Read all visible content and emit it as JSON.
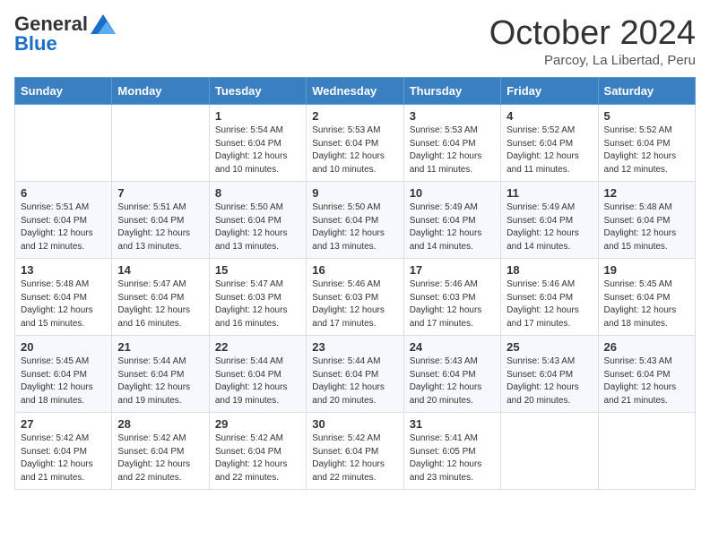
{
  "header": {
    "logo_general": "General",
    "logo_blue": "Blue",
    "title": "October 2024",
    "subtitle": "Parcoy, La Libertad, Peru"
  },
  "calendar": {
    "days_of_week": [
      "Sunday",
      "Monday",
      "Tuesday",
      "Wednesday",
      "Thursday",
      "Friday",
      "Saturday"
    ],
    "weeks": [
      [
        {
          "day": "",
          "info": ""
        },
        {
          "day": "",
          "info": ""
        },
        {
          "day": "1",
          "info": "Sunrise: 5:54 AM\nSunset: 6:04 PM\nDaylight: 12 hours and 10 minutes."
        },
        {
          "day": "2",
          "info": "Sunrise: 5:53 AM\nSunset: 6:04 PM\nDaylight: 12 hours and 10 minutes."
        },
        {
          "day": "3",
          "info": "Sunrise: 5:53 AM\nSunset: 6:04 PM\nDaylight: 12 hours and 11 minutes."
        },
        {
          "day": "4",
          "info": "Sunrise: 5:52 AM\nSunset: 6:04 PM\nDaylight: 12 hours and 11 minutes."
        },
        {
          "day": "5",
          "info": "Sunrise: 5:52 AM\nSunset: 6:04 PM\nDaylight: 12 hours and 12 minutes."
        }
      ],
      [
        {
          "day": "6",
          "info": "Sunrise: 5:51 AM\nSunset: 6:04 PM\nDaylight: 12 hours and 12 minutes."
        },
        {
          "day": "7",
          "info": "Sunrise: 5:51 AM\nSunset: 6:04 PM\nDaylight: 12 hours and 13 minutes."
        },
        {
          "day": "8",
          "info": "Sunrise: 5:50 AM\nSunset: 6:04 PM\nDaylight: 12 hours and 13 minutes."
        },
        {
          "day": "9",
          "info": "Sunrise: 5:50 AM\nSunset: 6:04 PM\nDaylight: 12 hours and 13 minutes."
        },
        {
          "day": "10",
          "info": "Sunrise: 5:49 AM\nSunset: 6:04 PM\nDaylight: 12 hours and 14 minutes."
        },
        {
          "day": "11",
          "info": "Sunrise: 5:49 AM\nSunset: 6:04 PM\nDaylight: 12 hours and 14 minutes."
        },
        {
          "day": "12",
          "info": "Sunrise: 5:48 AM\nSunset: 6:04 PM\nDaylight: 12 hours and 15 minutes."
        }
      ],
      [
        {
          "day": "13",
          "info": "Sunrise: 5:48 AM\nSunset: 6:04 PM\nDaylight: 12 hours and 15 minutes."
        },
        {
          "day": "14",
          "info": "Sunrise: 5:47 AM\nSunset: 6:04 PM\nDaylight: 12 hours and 16 minutes."
        },
        {
          "day": "15",
          "info": "Sunrise: 5:47 AM\nSunset: 6:03 PM\nDaylight: 12 hours and 16 minutes."
        },
        {
          "day": "16",
          "info": "Sunrise: 5:46 AM\nSunset: 6:03 PM\nDaylight: 12 hours and 17 minutes."
        },
        {
          "day": "17",
          "info": "Sunrise: 5:46 AM\nSunset: 6:03 PM\nDaylight: 12 hours and 17 minutes."
        },
        {
          "day": "18",
          "info": "Sunrise: 5:46 AM\nSunset: 6:04 PM\nDaylight: 12 hours and 17 minutes."
        },
        {
          "day": "19",
          "info": "Sunrise: 5:45 AM\nSunset: 6:04 PM\nDaylight: 12 hours and 18 minutes."
        }
      ],
      [
        {
          "day": "20",
          "info": "Sunrise: 5:45 AM\nSunset: 6:04 PM\nDaylight: 12 hours and 18 minutes."
        },
        {
          "day": "21",
          "info": "Sunrise: 5:44 AM\nSunset: 6:04 PM\nDaylight: 12 hours and 19 minutes."
        },
        {
          "day": "22",
          "info": "Sunrise: 5:44 AM\nSunset: 6:04 PM\nDaylight: 12 hours and 19 minutes."
        },
        {
          "day": "23",
          "info": "Sunrise: 5:44 AM\nSunset: 6:04 PM\nDaylight: 12 hours and 20 minutes."
        },
        {
          "day": "24",
          "info": "Sunrise: 5:43 AM\nSunset: 6:04 PM\nDaylight: 12 hours and 20 minutes."
        },
        {
          "day": "25",
          "info": "Sunrise: 5:43 AM\nSunset: 6:04 PM\nDaylight: 12 hours and 20 minutes."
        },
        {
          "day": "26",
          "info": "Sunrise: 5:43 AM\nSunset: 6:04 PM\nDaylight: 12 hours and 21 minutes."
        }
      ],
      [
        {
          "day": "27",
          "info": "Sunrise: 5:42 AM\nSunset: 6:04 PM\nDaylight: 12 hours and 21 minutes."
        },
        {
          "day": "28",
          "info": "Sunrise: 5:42 AM\nSunset: 6:04 PM\nDaylight: 12 hours and 22 minutes."
        },
        {
          "day": "29",
          "info": "Sunrise: 5:42 AM\nSunset: 6:04 PM\nDaylight: 12 hours and 22 minutes."
        },
        {
          "day": "30",
          "info": "Sunrise: 5:42 AM\nSunset: 6:04 PM\nDaylight: 12 hours and 22 minutes."
        },
        {
          "day": "31",
          "info": "Sunrise: 5:41 AM\nSunset: 6:05 PM\nDaylight: 12 hours and 23 minutes."
        },
        {
          "day": "",
          "info": ""
        },
        {
          "day": "",
          "info": ""
        }
      ]
    ]
  }
}
